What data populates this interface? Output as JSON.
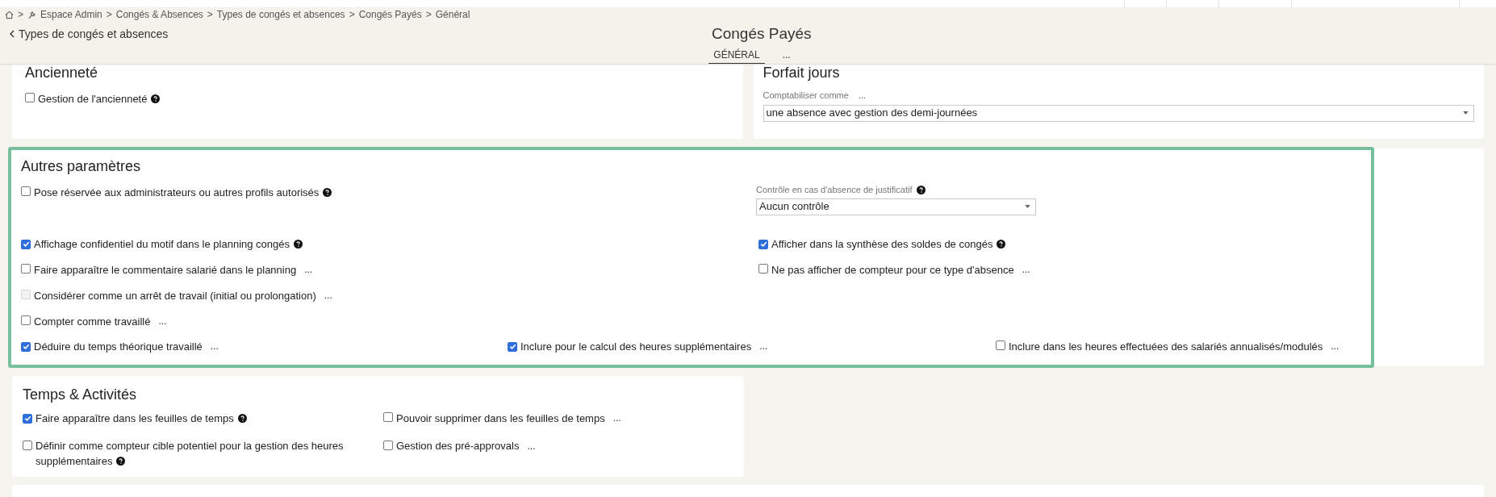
{
  "breadcrumb": {
    "separator": ">",
    "items": [
      "Espace Admin",
      "Congés & Absences",
      "Types de congés et absences",
      "Congés Payés",
      "Général"
    ]
  },
  "back_link": "Types de congés et absences",
  "title": "Congés Payés",
  "tabs": [
    {
      "label": "GÉNÉRAL",
      "selected": true
    },
    {
      "label": "...",
      "selected": false
    }
  ],
  "anciennete": {
    "title": "Ancienneté",
    "options": [
      {
        "label": "Gestion de l'ancienneté",
        "checked": false,
        "disabled": false,
        "help": true
      }
    ]
  },
  "forfait_jours": {
    "title": "Forfait jours",
    "field": {
      "label": "Comptabiliser comme",
      "more": "...",
      "value": "une absence avec gestion des demi-journées"
    }
  },
  "autres_parametres": {
    "title": "Autres paramètres",
    "highlighted": true,
    "left_options": [
      {
        "label": "Pose réservée aux administrateurs ou autres profils autorisés",
        "checked": false,
        "disabled": false,
        "help": true
      },
      {
        "label": "Affichage confidentiel du motif dans le planning congés",
        "checked": true,
        "disabled": false,
        "help": true
      },
      {
        "label": "Faire apparaître le commentaire salarié dans le planning",
        "checked": false,
        "disabled": false,
        "more": "..."
      },
      {
        "label": "Considérer comme un arrêt de travail (initial ou prolongation)",
        "checked": false,
        "disabled": true,
        "more": "..."
      },
      {
        "label": "Compter comme travaillé",
        "checked": false,
        "disabled": false,
        "more": "..."
      }
    ],
    "field": {
      "label": "Contrôle en cas d'absence de justificatif",
      "help": true,
      "value": "Aucun contrôle"
    },
    "right_options": [
      {
        "label": "Afficher dans la synthèse des soldes de congés",
        "checked": true,
        "disabled": false,
        "help": true
      },
      {
        "label": "Ne pas afficher de compteur pour ce type d'absence",
        "checked": false,
        "disabled": false,
        "more": "..."
      }
    ],
    "bottom_options": [
      {
        "label": "Déduire du temps théorique travaillé",
        "checked": true,
        "disabled": false,
        "more": "..."
      },
      {
        "label": "Inclure pour le calcul des heures supplémentaires",
        "checked": true,
        "disabled": false,
        "more": "..."
      },
      {
        "label": "Inclure dans les heures effectuées des salariés annualisés/modulés",
        "checked": false,
        "disabled": false,
        "more": "..."
      }
    ]
  },
  "temps_activites": {
    "title": "Temps & Activités",
    "options": [
      {
        "label": "Faire apparaître dans les feuilles de temps",
        "checked": true,
        "disabled": false,
        "help": true
      },
      {
        "label": "Pouvoir supprimer dans les feuilles de temps",
        "checked": false,
        "disabled": false,
        "more": "..."
      },
      {
        "label": "Définir comme compteur cible potentiel pour la gestion des heures supplémentaires",
        "checked": false,
        "disabled": false,
        "help": true
      },
      {
        "label": "Gestion des pré-approvals",
        "checked": false,
        "disabled": false,
        "more": "..."
      }
    ]
  }
}
